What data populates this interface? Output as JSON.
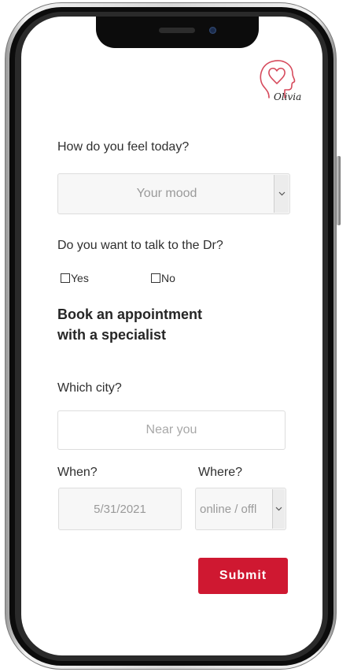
{
  "logo": {
    "text": "Olivia"
  },
  "mood": {
    "question": "How do you feel today?",
    "placeholder": "Your mood"
  },
  "doctor": {
    "question": "Do you want to talk to the Dr?",
    "yes_label": "Yes",
    "no_label": "No"
  },
  "booking": {
    "heading_line1": "Book an appointment",
    "heading_line2": "with a specialist"
  },
  "city": {
    "question": "Which city?",
    "placeholder": "Near you"
  },
  "when": {
    "label": "When?",
    "value": "5/31/2021"
  },
  "where": {
    "label": "Where?",
    "value": "online / offl"
  },
  "submit_label": "Submit",
  "colors": {
    "accent": "#cf1831",
    "logo_stroke": "#d64a5c"
  },
  "icons": [
    "heart-head-logo-icon",
    "chevron-down-icon"
  ]
}
